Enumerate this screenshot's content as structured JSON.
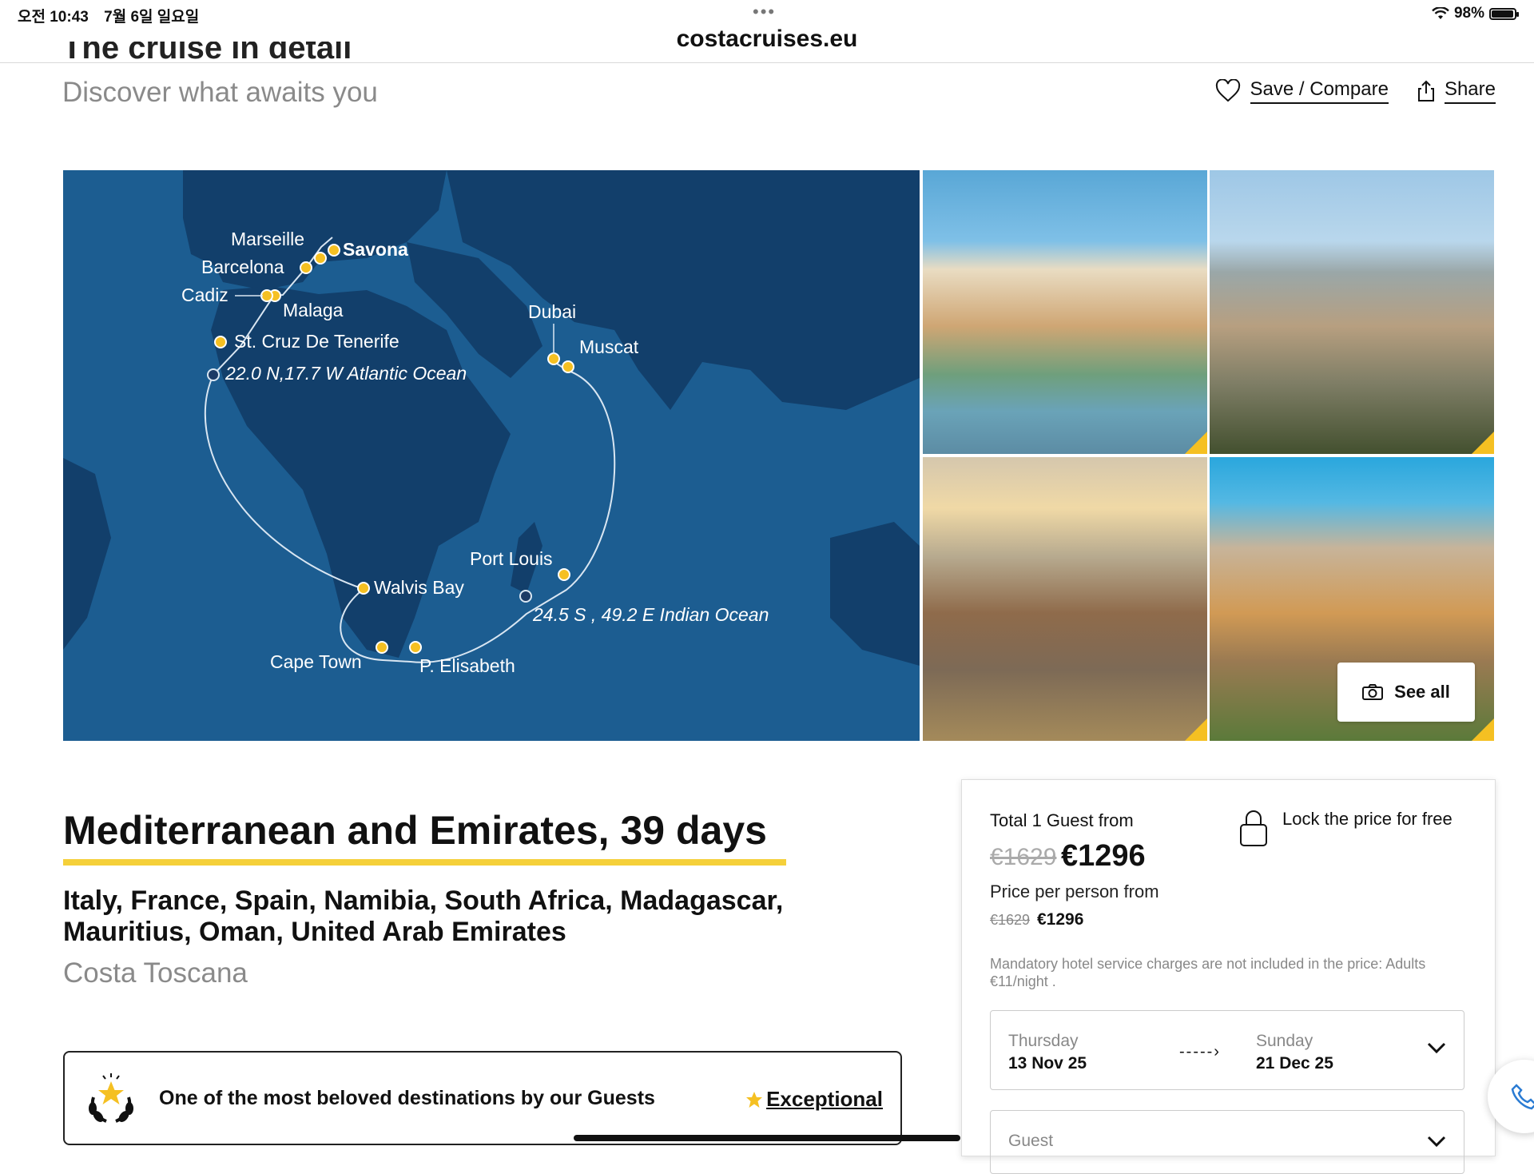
{
  "status_bar": {
    "time": "오전 10:43",
    "date": "7월 6일 일요일",
    "url": "costacruises.eu",
    "battery": "98%"
  },
  "header": {
    "cut_title": "The cruise in detail",
    "subtitle": "Discover what awaits you",
    "save_compare": "Save / Compare",
    "share": "Share"
  },
  "map": {
    "ports": [
      {
        "name": "Marseille"
      },
      {
        "name": "Savona"
      },
      {
        "name": "Barcelona"
      },
      {
        "name": "Cadiz"
      },
      {
        "name": "Malaga"
      },
      {
        "name": "St. Cruz De Tenerife"
      },
      {
        "name": "22.0 N,17.7 W Atlantic Ocean"
      },
      {
        "name": "Dubai"
      },
      {
        "name": "Muscat"
      },
      {
        "name": "Port Louis"
      },
      {
        "name": "Walvis Bay"
      },
      {
        "name": "24.5 S , 49.2 E Indian Ocean"
      },
      {
        "name": "Cape Town"
      },
      {
        "name": "P. Elisabeth"
      }
    ],
    "colors": {
      "ocean": "#1c5d91",
      "land": "#123f6b",
      "route": "#d9e6f2",
      "port": "#f5c022"
    }
  },
  "gallery": {
    "see_all": "See all",
    "accent": "#f5c022"
  },
  "cruise": {
    "title": "Mediterranean and Emirates, 39 days",
    "countries": "Italy, France, Spain, Namibia, South Africa, Madagascar, Mauritius, Oman, United Arab Emirates",
    "ship": "Costa Toscana"
  },
  "rating": {
    "text": "One of the most beloved destinations by our Guests",
    "badge": "Exceptional"
  },
  "price": {
    "total_label": "Total 1 Guest from",
    "lock_label": "Lock the price for free",
    "old_total": "€1629",
    "new_total": "€1296",
    "per_person_label": "Price per person from",
    "old_pp": "€1629",
    "new_pp": "€1296",
    "note": "Mandatory hotel service charges are not included in the price: Adults €11/night .",
    "from_day": "Thursday",
    "from_date": "13 Nov 25",
    "arrow": "-----›",
    "to_day": "Sunday",
    "to_date": "21 Dec 25",
    "guest_label": "Guest"
  }
}
